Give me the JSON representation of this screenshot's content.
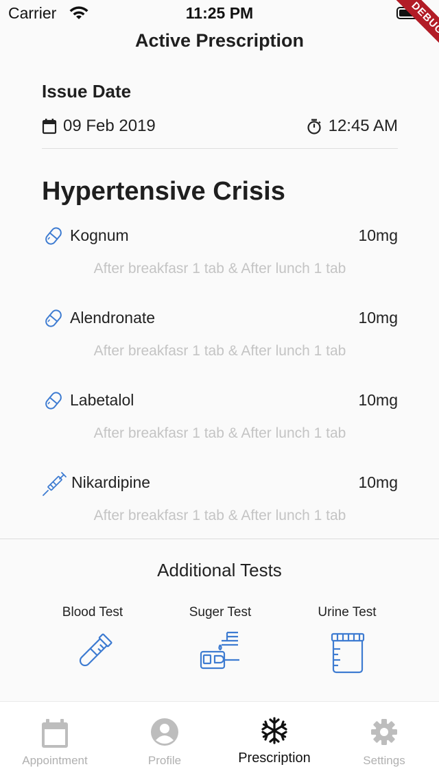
{
  "status_bar": {
    "carrier": "Carrier",
    "time": "11:25 PM",
    "debug_banner": "DEBUG"
  },
  "header": {
    "title": "Active Prescription"
  },
  "issue": {
    "label": "Issue Date",
    "date": "09 Feb 2019",
    "time": "12:45 AM"
  },
  "diagnosis": "Hypertensive Crisis",
  "medications": [
    {
      "name": "Kognum",
      "dose": "10mg",
      "instructions": "After breakfasr 1 tab & After lunch 1 tab",
      "icon": "pill-icon"
    },
    {
      "name": "Alendronate",
      "dose": "10mg",
      "instructions": "After breakfasr 1 tab & After lunch 1 tab",
      "icon": "pill-icon"
    },
    {
      "name": "Labetalol",
      "dose": "10mg",
      "instructions": "After breakfasr 1 tab & After lunch 1 tab",
      "icon": "pill-icon"
    },
    {
      "name": "Nikardipine",
      "dose": "10mg",
      "instructions": "After breakfasr 1 tab & After lunch 1 tab",
      "icon": "syringe-icon"
    }
  ],
  "additional_tests": {
    "title": "Additional Tests",
    "items": [
      {
        "label": "Blood Test",
        "icon": "test-tube-icon"
      },
      {
        "label": "Suger Test",
        "icon": "glucose-meter-icon"
      },
      {
        "label": "Urine Test",
        "icon": "urine-container-icon"
      }
    ]
  },
  "bottom_nav": {
    "items": [
      {
        "label": "Appointment",
        "icon": "calendar-icon",
        "active": false
      },
      {
        "label": "Profile",
        "icon": "person-icon",
        "active": false
      },
      {
        "label": "Prescription",
        "icon": "snowflake-icon",
        "active": true
      },
      {
        "label": "Settings",
        "icon": "gear-icon",
        "active": false
      }
    ]
  },
  "colors": {
    "accent_icon": "#3d7bd1",
    "muted_text": "#c4c4c4",
    "inactive_nav": "#b0b0b0",
    "debug_ribbon": "#b21c26"
  }
}
